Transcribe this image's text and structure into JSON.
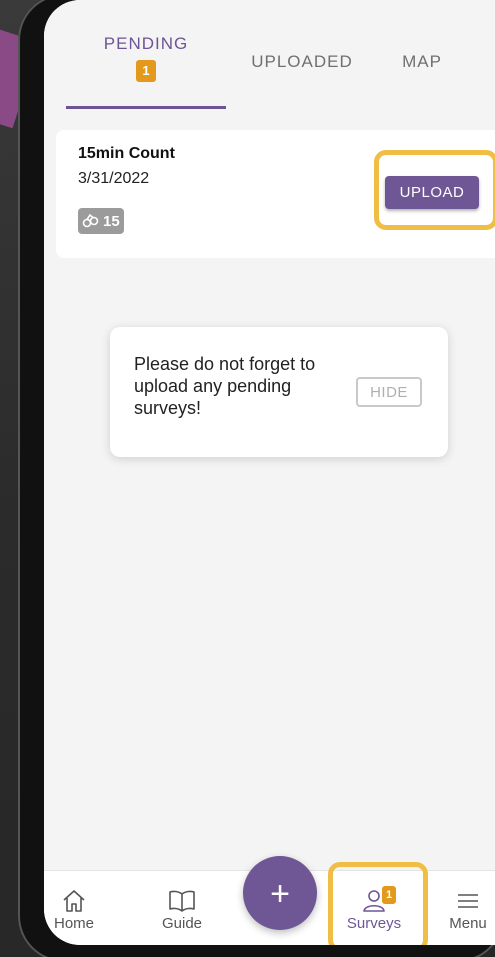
{
  "tabs": [
    {
      "label": "PENDING",
      "badge": "1",
      "active": true
    },
    {
      "label": "UPLOADED",
      "active": false
    },
    {
      "label": "MAP",
      "active": false
    }
  ],
  "survey_card": {
    "title": "15min Count",
    "date": "3/31/2022",
    "count_icon": "binoculars-icon",
    "count": "15",
    "upload_label": "UPLOAD"
  },
  "toast": {
    "message": "Please do not forget to upload any pending surveys!",
    "hide_label": "HIDE"
  },
  "bottom_nav": {
    "items": [
      {
        "label": "Home",
        "icon": "home-icon"
      },
      {
        "label": "Guide",
        "icon": "book-icon"
      },
      {
        "label": "Surveys",
        "icon": "user-icon",
        "badge": "1",
        "active": true
      },
      {
        "label": "Menu",
        "icon": "hamburger-icon"
      }
    ],
    "fab_label": "+"
  },
  "colors": {
    "accent": "#6f5694",
    "badge": "#e39a1c",
    "highlight": "#f0be44"
  }
}
